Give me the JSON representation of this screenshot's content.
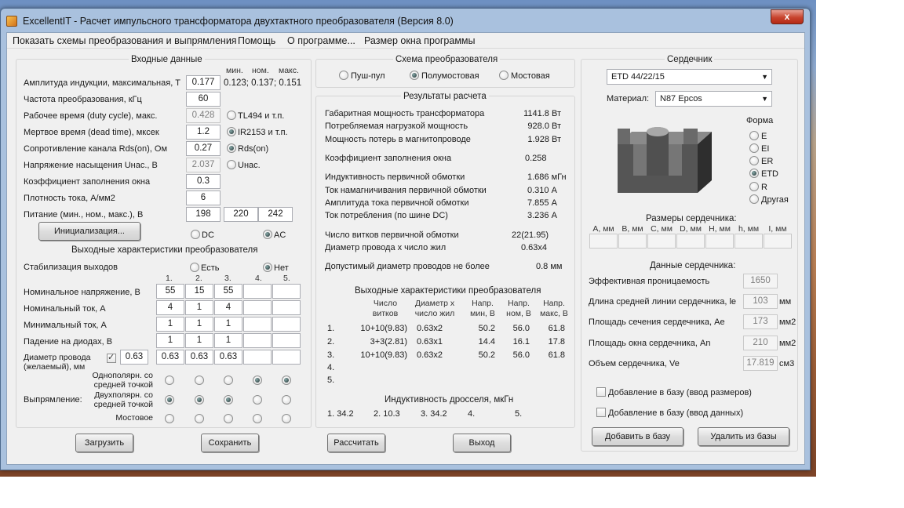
{
  "window": {
    "title": "ExcellentIT - Расчет импульсного трансформатора двухтактного преобразователя (Версия 8.0)",
    "close": "x"
  },
  "menu": [
    "Показать схемы преобразования и выпрямления",
    "Помощь",
    "О программе...",
    "Размер окна программы"
  ],
  "input": {
    "title": "Входные данные",
    "col_headers": [
      "мин.",
      "ном.",
      "макс."
    ],
    "induction": {
      "label": "Амплитуда индукции, максимальная, Т",
      "value": "0.177",
      "range": "0.123; 0.137; 0.151"
    },
    "freq": {
      "label": "Частота преобразования, кГц",
      "value": "60"
    },
    "duty": {
      "label": "Рабочее время (duty cycle), макс.",
      "value": "0.428"
    },
    "dead": {
      "label": "Мертвое время (dead time), мксек",
      "value": "1.2"
    },
    "rds": {
      "label": "Сопротивление канала Rds(on), Ом",
      "value": "0.27"
    },
    "usat": {
      "label": "Напряжение насыщения Uнас., В",
      "value": "2.037"
    },
    "fill": {
      "label": "Коэффициент заполнения окна",
      "value": "0.3"
    },
    "current_density": {
      "label": "Плотность тока, А/мм2",
      "value": "6"
    },
    "supply": {
      "label": "Питание (мин., ном., макс.), В",
      "values": [
        "198",
        "220",
        "242"
      ]
    },
    "radio_ctrl": [
      "TL494 и т.п.",
      "IR2153 и т.п."
    ],
    "radio_loss": [
      "Rds(on)",
      "Uнас."
    ],
    "init_btn": "Инициализация...",
    "dc": "DC",
    "ac": "AC"
  },
  "output": {
    "title": "Выходные характеристики преобразователя",
    "stab_label": "Стабилизация выходов",
    "stab_yes": "Есть",
    "stab_no": "Нет",
    "cols": [
      "1.",
      "2.",
      "3.",
      "4.",
      "5."
    ],
    "rows": [
      {
        "label": "Номинальное напряжение, В",
        "values": [
          "55",
          "15",
          "55",
          "",
          ""
        ]
      },
      {
        "label": "Номинальный ток, А",
        "values": [
          "4",
          "1",
          "4",
          "",
          ""
        ]
      },
      {
        "label": "Минимальный ток, А",
        "values": [
          "1",
          "1",
          "1",
          "",
          ""
        ]
      },
      {
        "label": "Падение на диодах, В",
        "values": [
          "1",
          "1",
          "1",
          "",
          ""
        ]
      }
    ],
    "wire_label": "Диаметр провода (желаемый), мм",
    "wire_main": "0.63",
    "wire_values": [
      "0.63",
      "0.63",
      "0.63",
      "",
      ""
    ],
    "rect_label": "Выпрямление:",
    "rect_options": [
      "Однополярн. со средней точкой",
      "Двухполярн. со средней точкой",
      "Мостовое"
    ],
    "rect_selected": [
      1,
      1,
      1,
      0,
      0
    ]
  },
  "buttons": {
    "load": "Загрузить",
    "save": "Сохранить",
    "calc": "Рассчитать",
    "exit": "Выход",
    "add_db": "Добавить в базу",
    "del_db": "Удалить из базы"
  },
  "scheme": {
    "title": "Схема преобразователя",
    "options": [
      "Пуш-пул",
      "Полумостовая",
      "Мостовая"
    ]
  },
  "results": {
    "title": "Результаты расчета",
    "lines": [
      {
        "label": "Габаритная мощность трансформатора",
        "value": "1141.8 Вт"
      },
      {
        "label": "Потребляемая нагрузкой мощность",
        "value": "928.0 Вт"
      },
      {
        "label": "Мощность потерь в магнитопроводе",
        "value": "1.928 Вт"
      },
      {
        "label": "Коэффициент заполнения окна",
        "value": "0.258"
      },
      {
        "label": "Индуктивность первичной обмотки",
        "value": "1.686 мГн"
      },
      {
        "label": "Ток намагничивания первичной обмотки",
        "value": "0.310 А"
      },
      {
        "label": "Амплитуда тока первичной обмотки",
        "value": "7.855 А"
      },
      {
        "label": "Ток потребления (по шине DC)",
        "value": "3.236 А"
      },
      {
        "label": "Число витков первичной обмотки",
        "value": "22(21.95)"
      },
      {
        "label": "Диаметр провода х число жил",
        "value": "0.63х4"
      },
      {
        "label": "Допустимый диаметр проводов не более",
        "value": "0.8 мм"
      }
    ],
    "out_title": "Выходные характеристики преобразователя",
    "out_headers": [
      "Число витков",
      "Диаметр х число жил",
      "Напр. мин, В",
      "Напр. ном, В",
      "Напр. макс, В"
    ],
    "out_rows": [
      {
        "n": "1.",
        "turns": "10+10(9.83)",
        "wire": "0.63х2",
        "vmin": "50.2",
        "vnom": "56.0",
        "vmax": "61.8"
      },
      {
        "n": "2.",
        "turns": "3+3(2.81)",
        "wire": "0.63х1",
        "vmin": "14.4",
        "vnom": "16.1",
        "vmax": "17.8"
      },
      {
        "n": "3.",
        "turns": "10+10(9.83)",
        "wire": "0.63х2",
        "vmin": "50.2",
        "vnom": "56.0",
        "vmax": "61.8"
      },
      {
        "n": "4.",
        "turns": "",
        "wire": "",
        "vmin": "",
        "vnom": "",
        "vmax": ""
      },
      {
        "n": "5.",
        "turns": "",
        "wire": "",
        "vmin": "",
        "vnom": "",
        "vmax": ""
      }
    ],
    "choke_title": "Индуктивность дросселя, мкГн",
    "choke": [
      "1. 34.2",
      "2. 10.3",
      "3. 34.2",
      "4.",
      "5."
    ]
  },
  "core": {
    "title": "Сердечник",
    "selected": "ETD 44/22/15",
    "material_label": "Материал:",
    "material": "N87 Epcos",
    "shape_label": "Форма",
    "shapes": [
      "E",
      "EI",
      "ER",
      "ETD",
      "R",
      "Другая"
    ],
    "shape_selected": "ETD",
    "dims_label": "Размеры сердечника:",
    "dims": [
      "A, мм",
      "B, мм",
      "C, мм",
      "D, мм",
      "H, мм",
      "h, мм",
      "I, мм"
    ],
    "data_label": "Данные сердечника:",
    "params": [
      {
        "label": "Эффективная проницаемость",
        "value": "1650",
        "unit": ""
      },
      {
        "label": "Длина средней линии сердечника, le",
        "value": "103",
        "unit": "мм"
      },
      {
        "label": "Площадь сечения сердечника, Ae",
        "value": "173",
        "unit": "мм2"
      },
      {
        "label": "Площадь окна сердечника, An",
        "value": "210",
        "unit": "мм2"
      },
      {
        "label": "Объем сердечника, Ve",
        "value": "17.819",
        "unit": "см3"
      }
    ],
    "cb_dims": "Добавление в базу (ввод размеров)",
    "cb_data": "Добавление в базу (ввод данных)"
  }
}
